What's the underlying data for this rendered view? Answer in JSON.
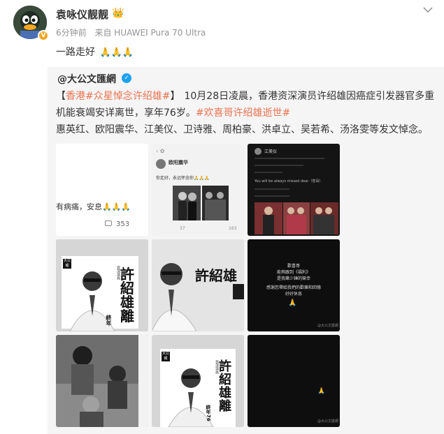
{
  "post": {
    "username": "袁咏仪靓靓",
    "time": "6分钟前",
    "source": "来自 HUAWEI Pura 70 Ultra",
    "text": "一路走好",
    "emoji": "🙏🙏🙏"
  },
  "repost": {
    "author": "@大公文匯網",
    "bracket_open": "【",
    "place": "香港",
    "hashtag1": "#众星悼念许绍雄#",
    "bracket_close": "】",
    "body1": "10月28日凌晨，香港资深演员许绍雄因癌症引发器官多重机能衰竭安详离世，享年76岁。",
    "hashtag2": "#欢喜哥许绍雄逝世#",
    "body2": "惠英红、欧阳震华、江美仪、卫诗雅、周柏豪、洪卓立、吴若希、汤洛雯等发文悼念。"
  },
  "images": {
    "img1_text": "有病痛，安息🙏🙏🙏",
    "img1_count": "353",
    "img2_title": "欧阳震华",
    "img2_text": "你走好，永远怀念你🙏🙏🙏",
    "img2_likes": "37",
    "img2_comments": "163",
    "img3_title": "江美仪",
    "img3_line1": "You will be always missed dear（苍哥）",
    "big_name": "許紹雄",
    "subtitle": "資深演員",
    "vertical_name_1": "許",
    "vertical_name_2": "紹",
    "vertical_name_3": "雄",
    "vertical_name_4": "離",
    "end_label": "終年",
    "end_label_76": "終年76",
    "stamp": "大公報",
    "dark_line1": "歡喜哥",
    "dark_line2": "能夠跟到《福利》",
    "dark_line3": "是我樂少錘的榮幸",
    "dark_line4": "感謝您帶給我們的歡樂和回憶",
    "dark_line5": "好好休息",
    "dark_pray": "🙏",
    "watermark": "@大公文匯網"
  }
}
